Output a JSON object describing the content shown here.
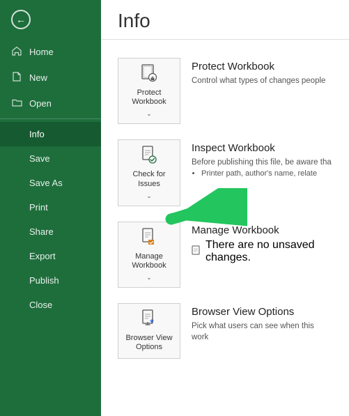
{
  "sidebar": {
    "back_icon": "←",
    "items": [
      {
        "id": "home",
        "label": "Home",
        "icon": "⌂"
      },
      {
        "id": "new",
        "label": "New",
        "icon": "📄"
      },
      {
        "id": "open",
        "label": "Open",
        "icon": "📂"
      },
      {
        "id": "info",
        "label": "Info",
        "icon": "",
        "active": true
      },
      {
        "id": "save",
        "label": "Save",
        "icon": ""
      },
      {
        "id": "save-as",
        "label": "Save As",
        "icon": ""
      },
      {
        "id": "print",
        "label": "Print",
        "icon": ""
      },
      {
        "id": "share",
        "label": "Share",
        "icon": ""
      },
      {
        "id": "export",
        "label": "Export",
        "icon": ""
      },
      {
        "id": "publish",
        "label": "Publish",
        "icon": ""
      },
      {
        "id": "close",
        "label": "Close",
        "icon": ""
      }
    ]
  },
  "main": {
    "title": "Info",
    "cards": [
      {
        "id": "protect-workbook",
        "button_label": "Protect\nWorkbook",
        "chevron": "˅",
        "icon_char": "🔒",
        "icon_type": "lock",
        "heading": "Protect Workbook",
        "description": "Control what types of changes people"
      },
      {
        "id": "check-for-issues",
        "button_label": "Check for\nIssues",
        "chevron": "˅",
        "icon_char": "✔",
        "icon_type": "check",
        "heading": "Inspect Workbook",
        "description": "Before publishing this file, be aware tha",
        "sub_items": [
          "Printer path, author's name, relate"
        ]
      },
      {
        "id": "manage-workbook",
        "button_label": "Manage\nWorkbook",
        "chevron": "˅",
        "icon_char": "📄",
        "icon_type": "doc-orange",
        "heading": "Manage Workbook",
        "sub_items_plain": [
          "There are no unsaved changes."
        ]
      },
      {
        "id": "browser-view-options",
        "button_label": "Browser View\nOptions",
        "icon_char": "🌐",
        "icon_type": "browser",
        "heading": "Browser View Options",
        "description": "Pick what users can see when this work"
      }
    ]
  }
}
